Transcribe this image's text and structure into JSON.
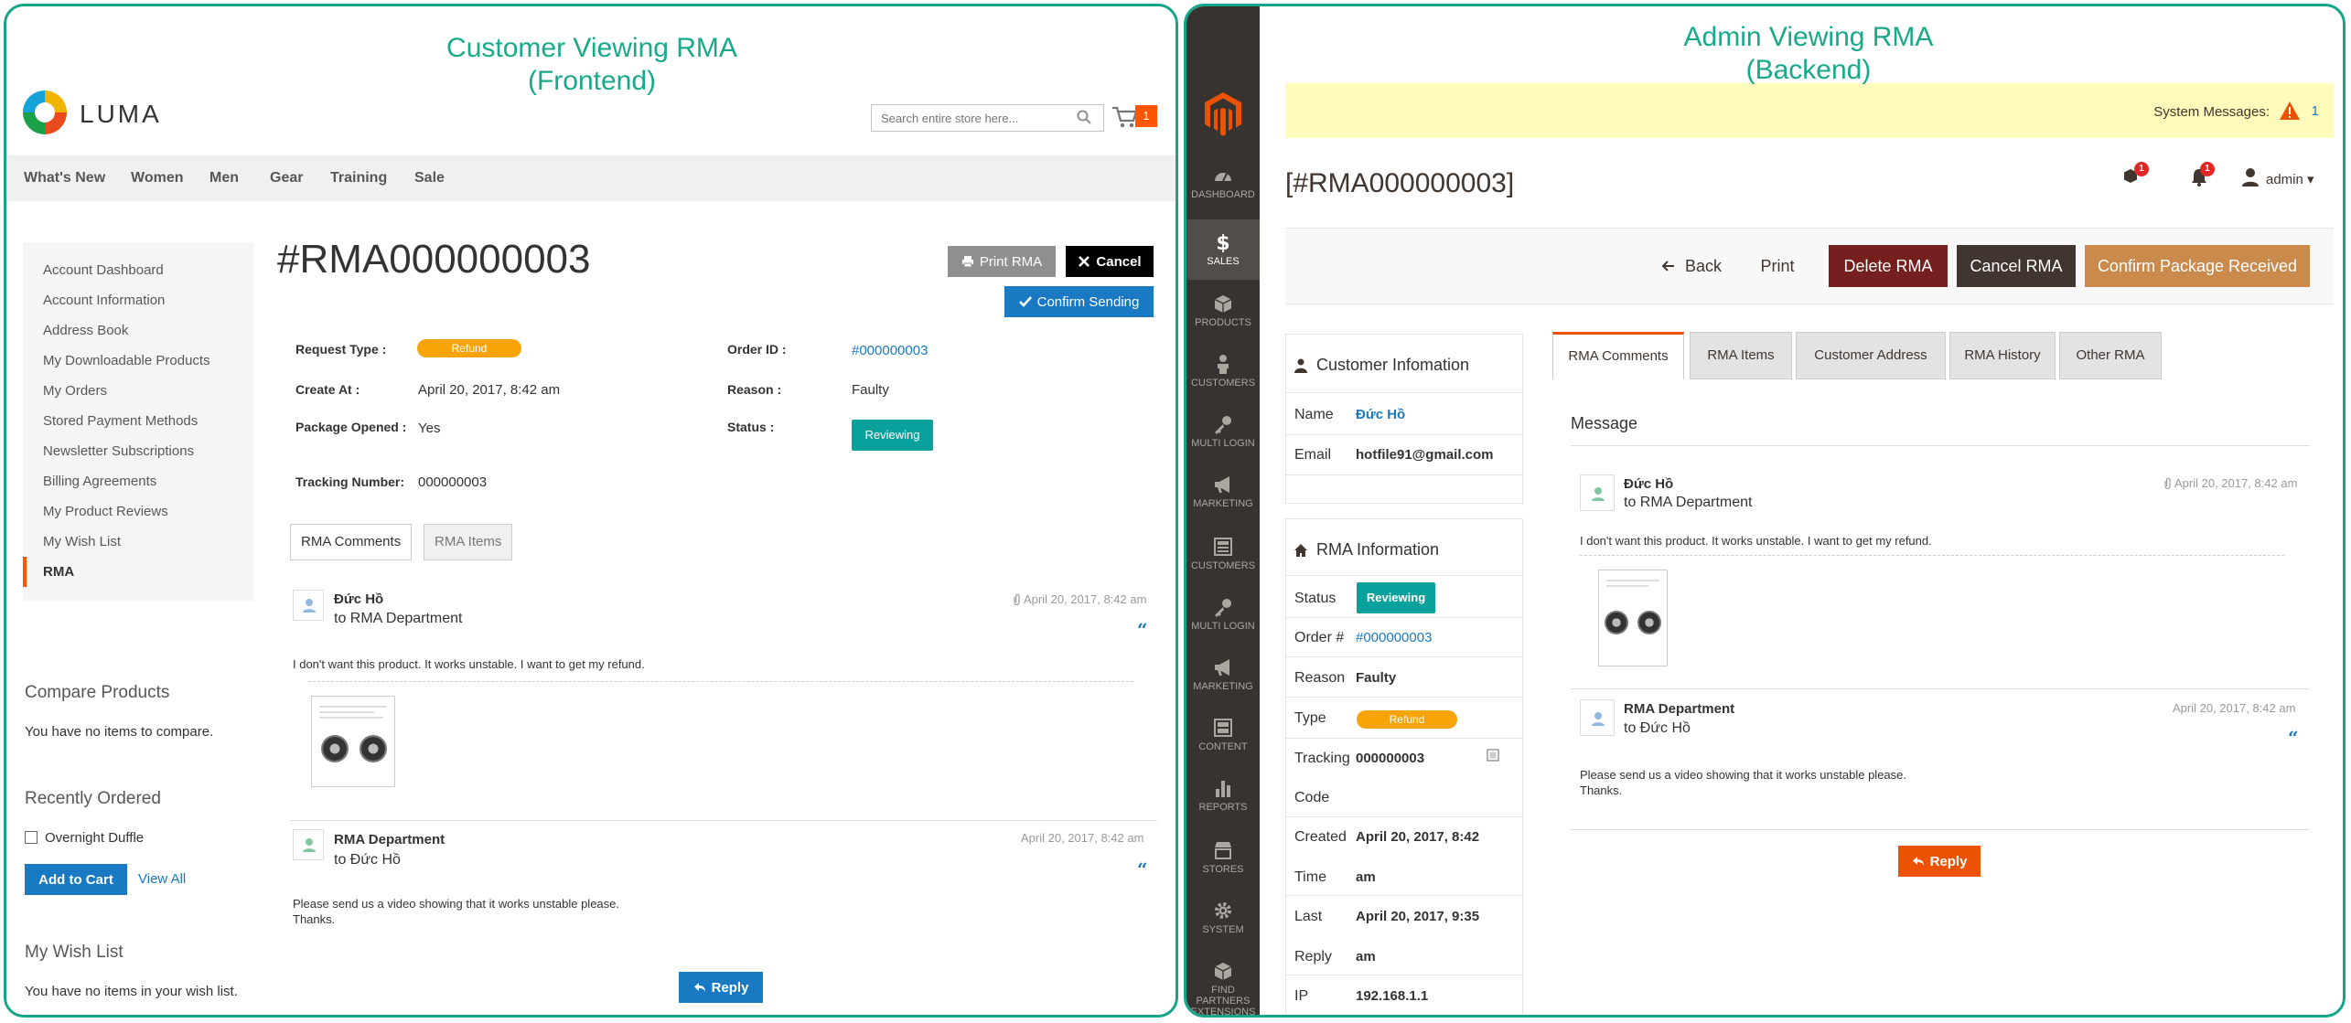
{
  "captions": {
    "left_line1": "Customer Viewing RMA",
    "left_line2": "(Frontend)",
    "right_line1": "Admin Viewing RMA",
    "right_line2": "(Backend)"
  },
  "frontend": {
    "logo_text": "LUMA",
    "search_placeholder": "Search entire store here...",
    "cart_count": "1",
    "nav": [
      "What's New",
      "Women",
      "Men",
      "Gear",
      "Training",
      "Sale"
    ],
    "sidebar": [
      "Account Dashboard",
      "Account Information",
      "Address Book",
      "My Downloadable Products",
      "My Orders",
      "Stored Payment Methods",
      "Newsletter Subscriptions",
      "Billing Agreements",
      "My Product Reviews",
      "My Wish List",
      "RMA"
    ],
    "compare": {
      "title": "Compare Products",
      "text": "You have no items to compare."
    },
    "recent": {
      "title": "Recently Ordered",
      "item": "Overnight Duffle",
      "add_to_cart": "Add to Cart",
      "view_all": "View All"
    },
    "wishlist": {
      "title": "My Wish List",
      "text": "You have no items in your wish list."
    },
    "rma_title": "#RMA000000003",
    "buttons": {
      "print": "Print RMA",
      "cancel": "Cancel",
      "confirm": "Confirm Sending",
      "reply": "Reply"
    },
    "fields": {
      "request_type_label": "Request Type :",
      "request_type": "Refund",
      "create_at_label": "Create At :",
      "create_at": "April 20, 2017, 8:42 am",
      "package_opened_label": "Package Opened :",
      "package_opened": "Yes",
      "tracking_label": "Tracking Number:",
      "tracking": "000000003",
      "order_id_label": "Order ID :",
      "order_id": "#000000003",
      "reason_label": "Reason :",
      "reason": "Faulty",
      "status_label": "Status :",
      "status": "Reviewing"
    },
    "tabs": [
      "RMA Comments",
      "RMA Items"
    ],
    "comments": [
      {
        "author": "Đức Hồ",
        "to": "to RMA Department",
        "date": "April 20, 2017, 8:42 am",
        "text": "I don't want this product. It works unstable. I want to get my refund."
      },
      {
        "author": "RMA Department",
        "to": "to Đức Hồ",
        "date": "April 20, 2017, 8:42 am",
        "text1": "Please send us a video showing that it works unstable please.",
        "text2": "Thanks."
      }
    ]
  },
  "backend": {
    "menu": [
      "DASHBOARD",
      "SALES",
      "PRODUCTS",
      "CUSTOMERS",
      "MULTI LOGIN",
      "MARKETING",
      "CUSTOMERS",
      "MULTI LOGIN",
      "MARKETING",
      "CONTENT",
      "REPORTS",
      "STORES",
      "SYSTEM",
      "FIND PARTNERS",
      "EXTENSIONS"
    ],
    "system_messages_label": "System Messages:",
    "system_messages_count": "1",
    "title": "[#RMA000000003]",
    "header_badges": [
      "1",
      "1"
    ],
    "admin_user": "admin",
    "buttons": {
      "back": "Back",
      "print": "Print",
      "delete": "Delete RMA",
      "cancel": "Cancel RMA",
      "confirm": "Confirm Package Received",
      "reply": "Reply"
    },
    "customer_box": {
      "title": "Customer Infomation",
      "name_label": "Name",
      "name": "Đức Hồ",
      "email_label": "Email",
      "email": "hotfile91@gmail.com"
    },
    "rma_box": {
      "title": "RMA Information",
      "status_label": "Status",
      "status": "Reviewing",
      "order_label": "Order #",
      "order": "#000000003",
      "reason_label": "Reason",
      "reason": "Faulty",
      "type_label": "Type",
      "type": "Refund",
      "tracking_label1": "Tracking",
      "tracking_label2": "Code",
      "tracking": "000000003",
      "created_label1": "Created",
      "created_label2": "Time",
      "created1": "April 20, 2017, 8:42",
      "created2": "am",
      "reply_label1": "Last",
      "reply_label2": "Reply",
      "reply1": "April 20, 2017, 9:35",
      "reply2": "am",
      "ip_label": "IP",
      "ip": "192.168.1.1"
    },
    "tabs": [
      "RMA Comments",
      "RMA Items",
      "Customer Address",
      "RMA History",
      "Other RMA"
    ],
    "message_title": "Message",
    "comments": [
      {
        "author": "Đức Hồ",
        "to": "to RMA Department",
        "date": "April 20, 2017, 8:42 am",
        "text": "I don't want this product. It works unstable. I want to get my refund."
      },
      {
        "author": "RMA Department",
        "to": "to Đức Hồ",
        "date": "April 20, 2017, 8:42 am",
        "text1": "Please send us a video showing that it works unstable please.",
        "text2": "Thanks."
      }
    ]
  },
  "colors": {
    "teal_border": "#15a58a",
    "luma_blue": "#1979c3",
    "magento_orange": "#eb5202",
    "status_teal": "#09a19c",
    "refund_yellow": "#f8a308",
    "delete_red": "#761f1f",
    "cancel_dark": "#41362f",
    "confirm_tan": "#c98a4c"
  },
  "icons": [
    "search-icon",
    "cart-icon",
    "printer-icon",
    "close-icon",
    "check-icon",
    "user-icon",
    "paperclip-icon",
    "quote-icon",
    "reply-icon",
    "magento-logo-icon",
    "dashboard-icon",
    "dollar-icon",
    "box-icon",
    "person-icon",
    "key-icon",
    "megaphone-icon",
    "layout-icon",
    "bar-chart-icon",
    "store-icon",
    "gear-icon",
    "cube-icon",
    "warning-icon",
    "search-box-icon",
    "bell-icon",
    "arrow-left-icon",
    "home-icon",
    "copy-icon"
  ]
}
